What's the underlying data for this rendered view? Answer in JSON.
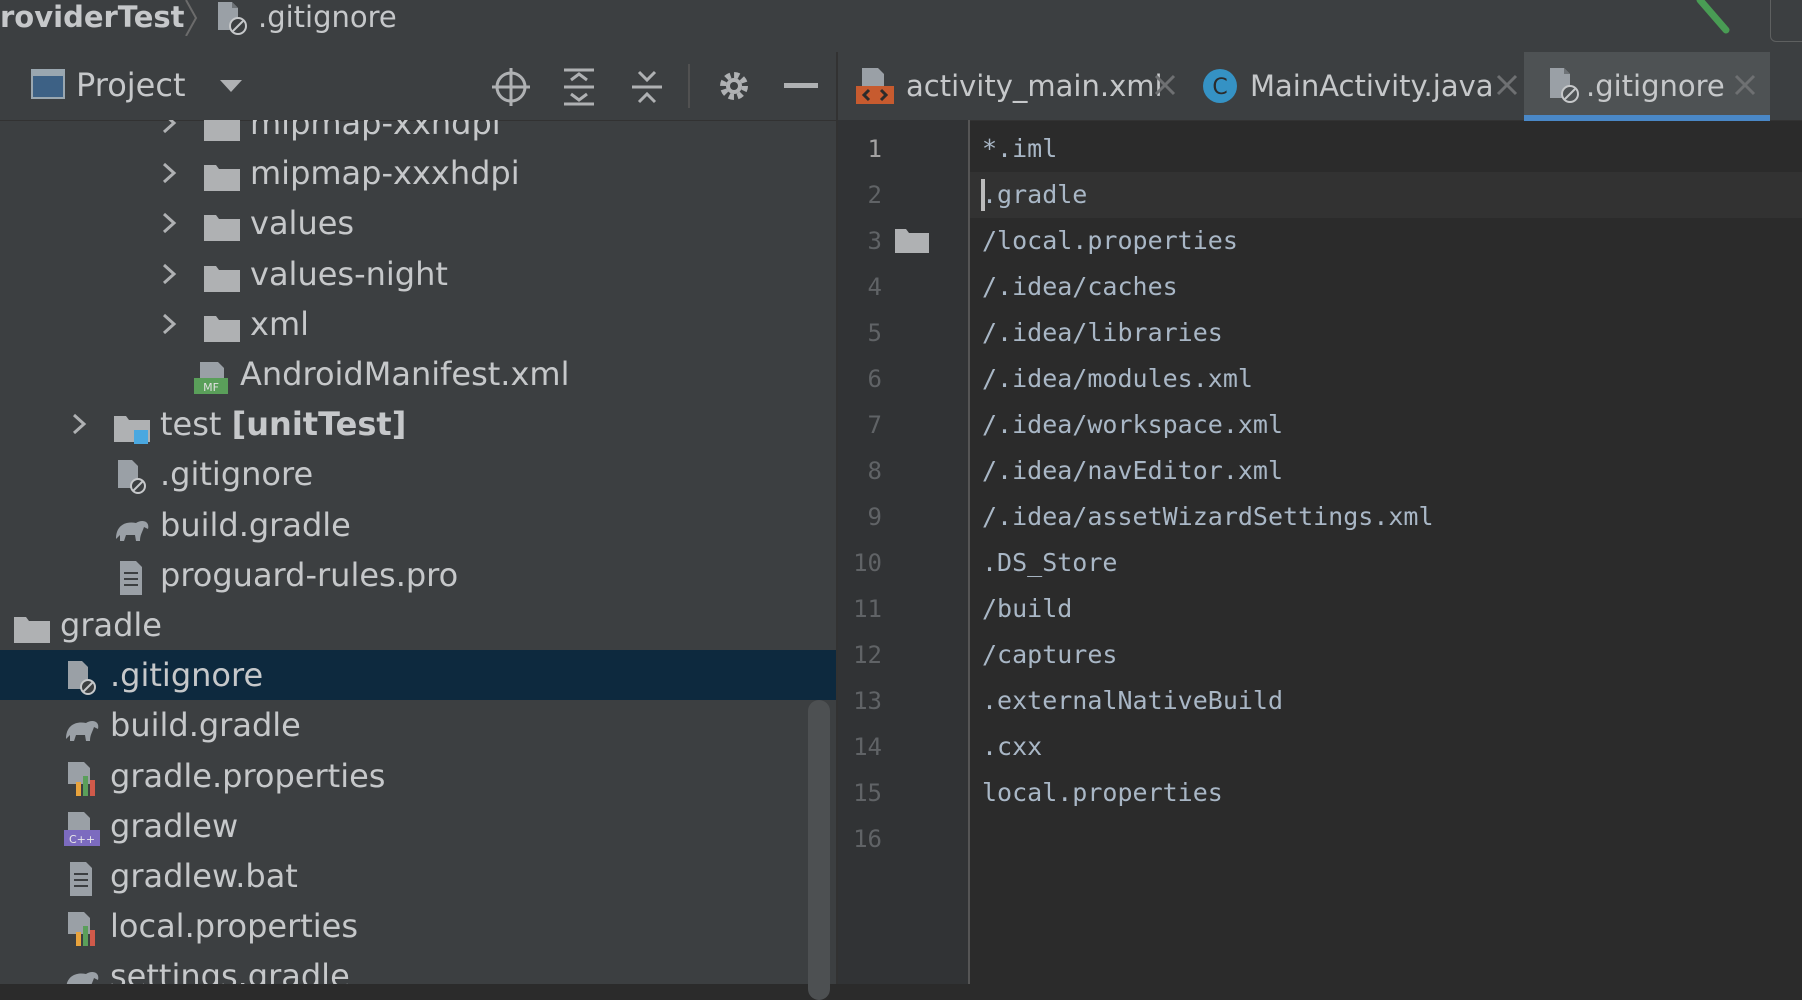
{
  "breadcrumb": {
    "project": "roviderTest",
    "file": ".gitignore"
  },
  "project_panel": {
    "view_title": "Project",
    "tree": [
      {
        "label": "mipmap-xxhdpi",
        "type": "folder",
        "expandable": true
      },
      {
        "label": "mipmap-xxxhdpi",
        "type": "folder",
        "expandable": true
      },
      {
        "label": "values",
        "type": "folder",
        "expandable": true
      },
      {
        "label": "values-night",
        "type": "folder",
        "expandable": true
      },
      {
        "label": "xml",
        "type": "folder",
        "expandable": true
      },
      {
        "label": "AndroidManifest.xml",
        "type": "manifest",
        "expandable": false
      },
      {
        "label": "test",
        "label_bold": "[unitTest]",
        "type": "test-folder",
        "expandable": true
      },
      {
        "label": ".gitignore",
        "type": "gitignore",
        "expandable": false
      },
      {
        "label": "build.gradle",
        "type": "gradle",
        "expandable": false
      },
      {
        "label": "proguard-rules.pro",
        "type": "text",
        "expandable": false
      },
      {
        "label": "gradle",
        "type": "folder",
        "expandable": true
      },
      {
        "label": ".gitignore",
        "type": "gitignore",
        "expandable": false,
        "selected": true
      },
      {
        "label": "build.gradle",
        "type": "gradle",
        "expandable": false
      },
      {
        "label": "gradle.properties",
        "type": "properties",
        "expandable": false
      },
      {
        "label": "gradlew",
        "type": "shell",
        "expandable": false
      },
      {
        "label": "gradlew.bat",
        "type": "text",
        "expandable": false
      },
      {
        "label": "local.properties",
        "type": "properties",
        "expandable": false
      },
      {
        "label": "settings.gradle",
        "type": "gradle",
        "expandable": false
      }
    ]
  },
  "editor": {
    "tabs": [
      {
        "label": "activity_main.xml",
        "icon": "xml-layout-icon",
        "active": false
      },
      {
        "label": "MainActivity.java",
        "icon": "java-class-icon",
        "active": false
      },
      {
        "label": ".gitignore",
        "icon": "gitignore-file-icon",
        "active": true
      }
    ],
    "line_numbers": [
      "1",
      "2",
      "3",
      "4",
      "5",
      "6",
      "7",
      "8",
      "9",
      "10",
      "11",
      "12",
      "13",
      "14",
      "15",
      "16"
    ],
    "lines": [
      "*.iml",
      ".gradle",
      "/local.properties",
      "/.idea/caches",
      "/.idea/libraries",
      "/.idea/modules.xml",
      "/.idea/workspace.xml",
      "/.idea/navEditor.xml",
      "/.idea/assetWizardSettings.xml",
      ".DS_Store",
      "/build",
      "/captures",
      ".externalNativeBuild",
      ".cxx",
      "local.properties",
      ""
    ]
  },
  "colors": {
    "accent": "#4a88c7",
    "selection": "#0d293e",
    "panel_bg": "#3c3f41",
    "editor_bg": "#2b2b2b",
    "build_hammer": "#499c54"
  }
}
